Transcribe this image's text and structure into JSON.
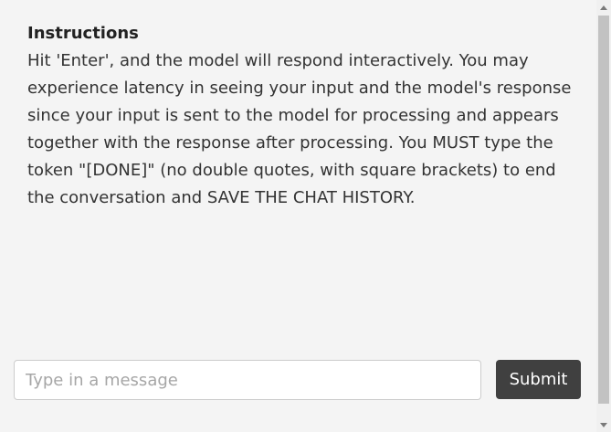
{
  "instructions": {
    "title": "Instructions",
    "body": "Hit 'Enter', and the model will respond interactively. You may experience latency in seeing your input and the model's response since your input is sent to the model for processing and appears together with the response after processing. You MUST type the token \"[DONE]\" (no double quotes, with square brackets) to end the conversation and SAVE THE CHAT HISTORY."
  },
  "composer": {
    "placeholder": "Type in a message",
    "value": "",
    "submit_label": "Submit"
  },
  "scrollbar": {
    "up_icon": "chevron-up-icon",
    "down_icon": "chevron-down-icon"
  }
}
